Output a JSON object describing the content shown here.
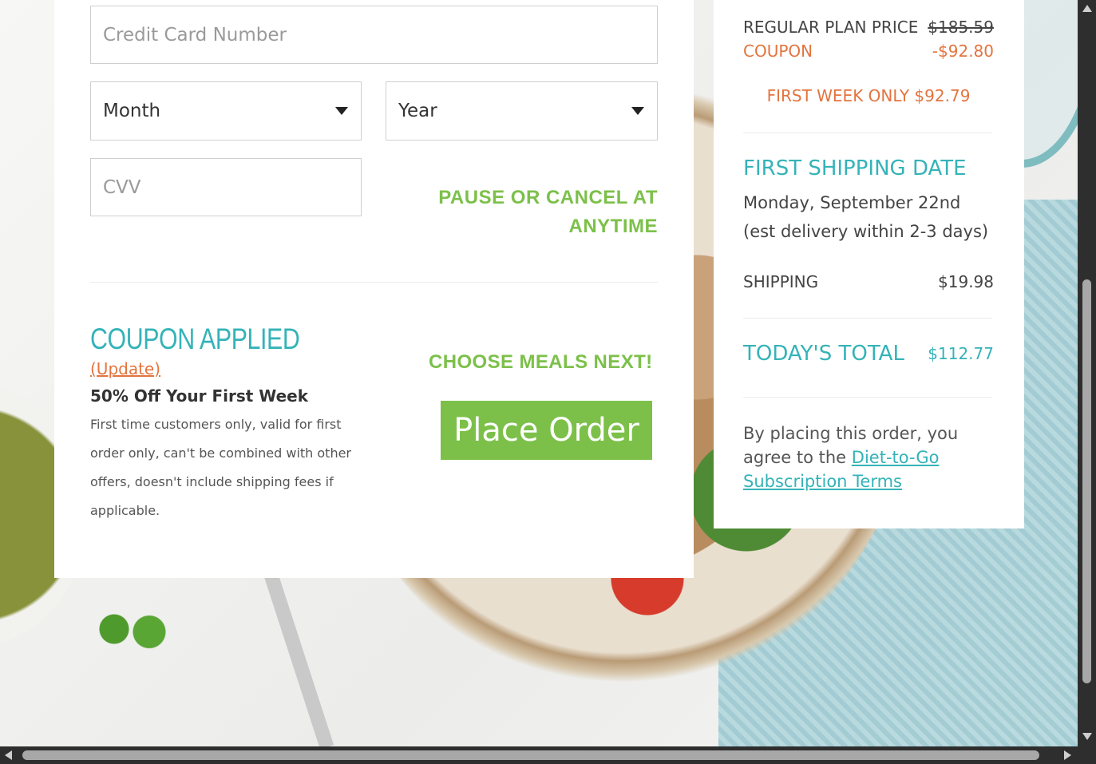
{
  "payment": {
    "card_number_placeholder": "Credit Card Number",
    "month_selected": "Month",
    "year_selected": "Year",
    "cvv_placeholder": "CVV",
    "pause_notice": "PAUSE OR CANCEL AT ANYTIME"
  },
  "coupon": {
    "title": "COUPON APPLIED",
    "update_link": "(Update)",
    "name": "50% Off Your First Week",
    "description": "First time customers only, valid for first order only, can't be combined with other offers, doesn't include shipping fees if applicable."
  },
  "order": {
    "choose_meals": "CHOOSE MEALS NEXT!",
    "place_order_label": "Place Order"
  },
  "summary": {
    "regular_label": "REGULAR PLAN PRICE",
    "regular_price": "$185.59",
    "coupon_label": "COUPON",
    "coupon_amount": "-$92.80",
    "first_week": "FIRST WEEK ONLY $92.79",
    "shipping_date_heading": "FIRST SHIPPING DATE",
    "shipping_date": "Monday, September 22nd",
    "delivery_estimate": "(est delivery within 2-3 days)",
    "shipping_label": "SHIPPING",
    "shipping_price": "$19.98",
    "total_label": "TODAY'S TOTAL",
    "total_price": "$112.77",
    "agree_prefix": "By placing this order, you agree to the ",
    "terms_link": "Diet-to-Go Subscription Terms"
  },
  "colors": {
    "accent_green": "#7cc04a",
    "accent_teal": "#34b3b8",
    "accent_orange": "#e3743e"
  }
}
